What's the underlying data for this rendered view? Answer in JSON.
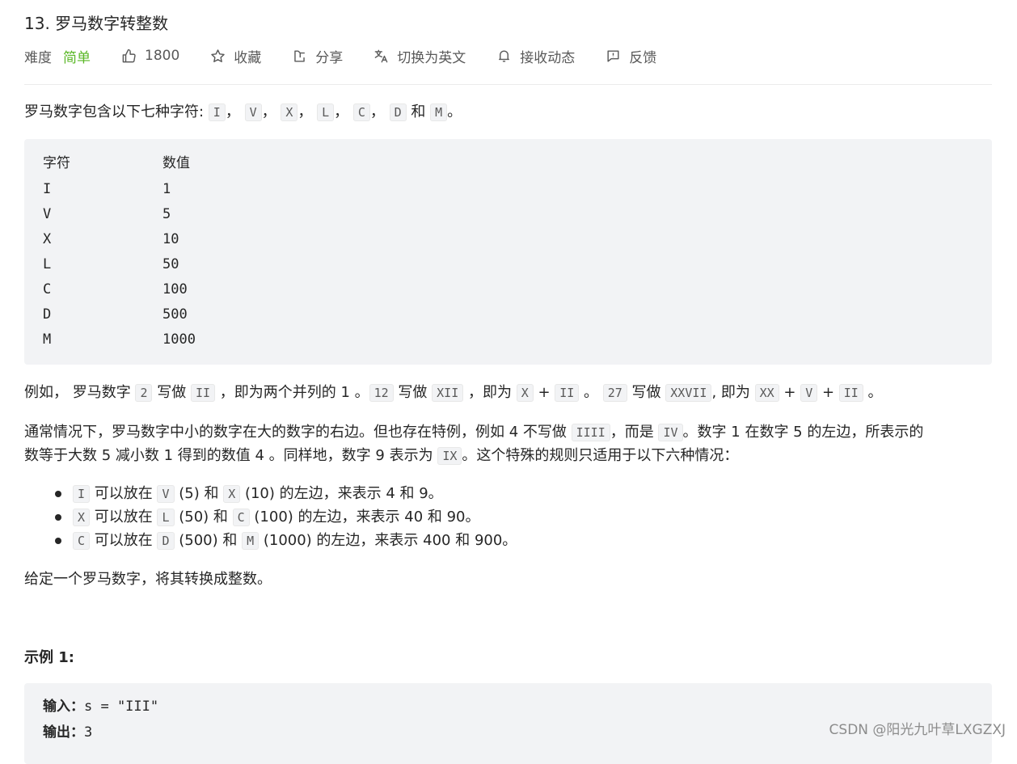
{
  "problem": {
    "title": "13. 罗马数字转整数"
  },
  "toolbar": {
    "difficulty_label": "难度",
    "difficulty_value": "简单",
    "like_count": "1800",
    "favorite_label": "收藏",
    "share_label": "分享",
    "switch_lang_label": "切换为英文",
    "notify_label": "接收动态",
    "feedback_label": "反馈"
  },
  "intro": {
    "prefix": "罗马数字包含以下七种字符: ",
    "chars": [
      "I",
      "V",
      "X",
      "L",
      "C",
      "D",
      "M"
    ],
    "sep": "，",
    "and": " 和 ",
    "end": "。"
  },
  "symbol_table": {
    "headers": [
      "字符",
      "数值"
    ],
    "rows": [
      [
        "I",
        "1"
      ],
      [
        "V",
        "5"
      ],
      [
        "X",
        "10"
      ],
      [
        "L",
        "50"
      ],
      [
        "C",
        "100"
      ],
      [
        "D",
        "500"
      ],
      [
        "M",
        "1000"
      ]
    ]
  },
  "example_para": {
    "t0": "例如， 罗马数字 ",
    "c0": "2",
    "t1": " 写做 ",
    "c1": "II",
    "t2": " ，即为两个并列的 1 。",
    "c2": "12",
    "t3": " 写做 ",
    "c3": "XII",
    "t4": " ，即为 ",
    "c4": "X",
    "t5": " + ",
    "c5": "II",
    "t6": " 。 ",
    "c6": "27",
    "t7": " 写做  ",
    "c7": "XXVII",
    "t8": ", 即为 ",
    "c8": "XX",
    "t9": " + ",
    "c9": "V",
    "t10": " + ",
    "c10": "II",
    "t11": " 。"
  },
  "rule_para": {
    "l1_a": "通常情况下，罗马数字中小的数字在大的数字的右边。但也存在特例，例如 4 不写做 ",
    "l1_c1": "IIII",
    "l1_b": "，而是 ",
    "l1_c2": "IV",
    "l1_d": "。数字 1 在数字 5 的左边，所表示的",
    "l2_a": "数等于大数 5 减小数 1 得到的数值 4 。同样地，数字 9 表示为 ",
    "l2_c": "IX",
    "l2_b": "。这个特殊的规则只适用于以下六种情况："
  },
  "rules": [
    {
      "c1": "I",
      "t1": " 可以放在 ",
      "c2": "V",
      "t2": " (5) 和 ",
      "c3": "X",
      "t3": " (10) 的左边，来表示 4 和 9。"
    },
    {
      "c1": "X",
      "t1": " 可以放在 ",
      "c2": "L",
      "t2": " (50) 和 ",
      "c3": "C",
      "t3": " (100) 的左边，来表示 40 和 90。"
    },
    {
      "c1": "C",
      "t1": " 可以放在 ",
      "c2": "D",
      "t2": " (500) 和 ",
      "c3": "M",
      "t3": " (1000) 的左边，来表示 400 和 900。"
    }
  ],
  "task": "给定一个罗马数字，将其转换成整数。",
  "example1": {
    "title": "示例 1:",
    "input_label": "输入：",
    "input_value": "s = \"III\"",
    "output_label": "输出：",
    "output_value": "3"
  },
  "watermark": "CSDN @阳光九叶草LXGZXJ"
}
